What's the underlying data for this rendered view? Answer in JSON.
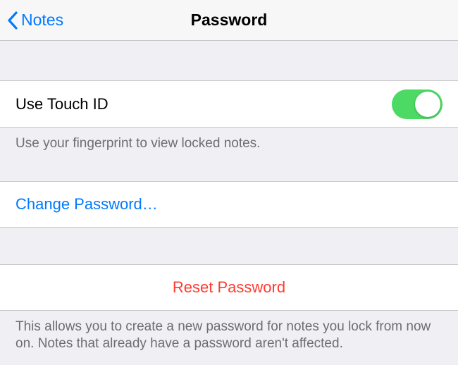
{
  "navbar": {
    "back_label": "Notes",
    "title": "Password"
  },
  "touch_id": {
    "label": "Use Touch ID",
    "footer": "Use your fingerprint to view locked notes."
  },
  "change_password": {
    "label": "Change Password…"
  },
  "reset": {
    "label": "Reset Password",
    "footer": "This allows you to create a new password for notes you lock from now on. Notes that already have a password aren't affected."
  }
}
